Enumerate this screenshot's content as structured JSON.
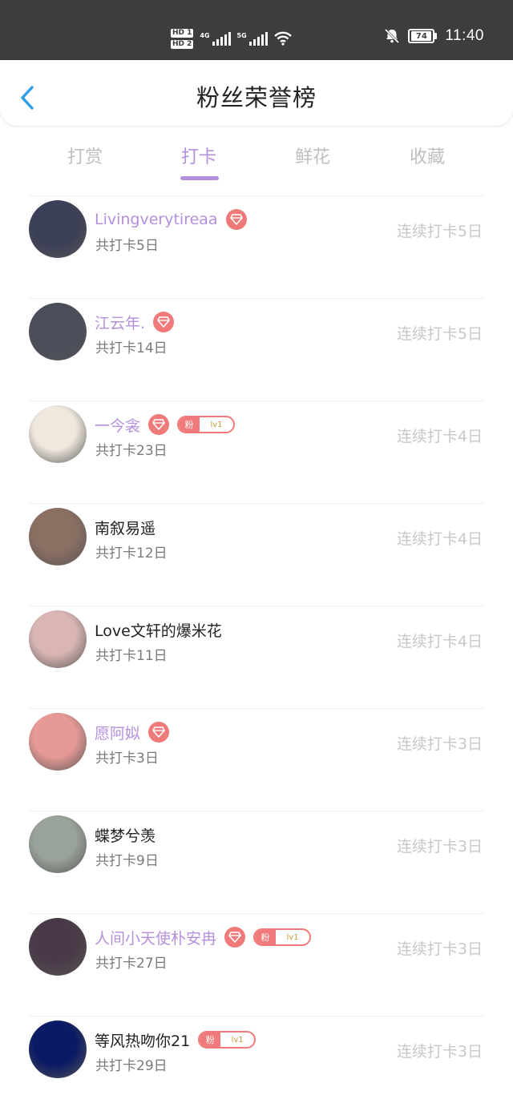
{
  "status_bar": {
    "sim1": "HD 1",
    "sim2": "HD 2",
    "net1": "4G",
    "net2": "5G",
    "battery": "74",
    "time": "11:40"
  },
  "header": {
    "title": "粉丝荣誉榜"
  },
  "tabs": [
    {
      "label": "打赏",
      "active": false
    },
    {
      "label": "打卡",
      "active": true
    },
    {
      "label": "鲜花",
      "active": false
    },
    {
      "label": "收藏",
      "active": false
    }
  ],
  "fan_badge": {
    "prefix": "粉",
    "level": "lv1"
  },
  "fans": [
    {
      "name": "Livingverytireaa",
      "total": "共打卡5日",
      "streak": "连续打卡5日",
      "vip": true,
      "gem": true,
      "fan": false
    },
    {
      "name": "江云年.",
      "total": "共打卡14日",
      "streak": "连续打卡5日",
      "vip": true,
      "gem": true,
      "fan": false
    },
    {
      "name": "一今衾",
      "total": "共打卡23日",
      "streak": "连续打卡4日",
      "vip": true,
      "gem": true,
      "fan": true
    },
    {
      "name": "南叙易遥",
      "total": "共打卡12日",
      "streak": "连续打卡4日",
      "vip": false,
      "gem": false,
      "fan": false
    },
    {
      "name": "Love文轩的爆米花",
      "total": "共打卡11日",
      "streak": "连续打卡4日",
      "vip": false,
      "gem": false,
      "fan": false
    },
    {
      "name": "愿阿姒",
      "total": "共打卡3日",
      "streak": "连续打卡3日",
      "vip": true,
      "gem": true,
      "fan": false
    },
    {
      "name": "蝶梦兮羡",
      "total": "共打卡9日",
      "streak": "连续打卡3日",
      "vip": false,
      "gem": false,
      "fan": false
    },
    {
      "name": "人间小天使朴安冉",
      "total": "共打卡27日",
      "streak": "连续打卡3日",
      "vip": true,
      "gem": true,
      "fan": true
    },
    {
      "name": "等风热吻你21",
      "total": "共打卡29日",
      "streak": "连续打卡3日",
      "vip": false,
      "gem": false,
      "fan": true
    }
  ],
  "colors": {
    "accent": "#b48fdc",
    "badge": "#f07a7a",
    "status_bar": "#3d3d3d",
    "muted": "#c8c8c8"
  },
  "avatars": [
    "#3b3f57",
    "#4a4d5a",
    "#efe8de",
    "#8b6f63",
    "#d9b6b4",
    "#e79a95",
    "#9aa39a",
    "#4a3a48",
    "#0b1a64"
  ]
}
